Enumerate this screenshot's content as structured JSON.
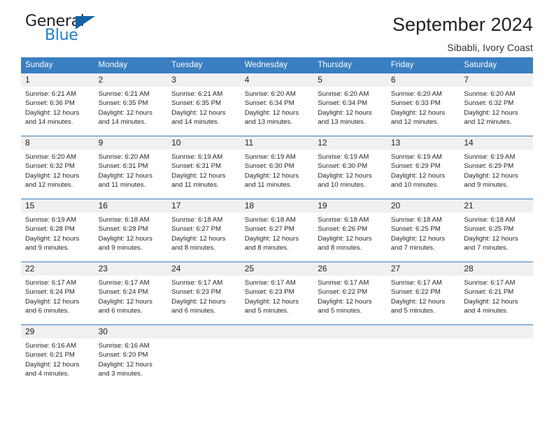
{
  "brand": {
    "name_part1": "General",
    "name_part2": "Blue"
  },
  "header": {
    "title": "September 2024",
    "subtitle": "Sibabli, Ivory Coast"
  },
  "weekday_headers": [
    "Sunday",
    "Monday",
    "Tuesday",
    "Wednesday",
    "Thursday",
    "Friday",
    "Saturday"
  ],
  "colors": {
    "header_blue": "#3a7fc1",
    "daynum_band": "#f0f0f0",
    "brand_blue": "#1f7ec4",
    "text": "#262626"
  },
  "weeks": [
    [
      {
        "day": "1",
        "sunrise": "Sunrise: 6:21 AM",
        "sunset": "Sunset: 6:36 PM",
        "daylight1": "Daylight: 12 hours",
        "daylight2": "and 14 minutes."
      },
      {
        "day": "2",
        "sunrise": "Sunrise: 6:21 AM",
        "sunset": "Sunset: 6:35 PM",
        "daylight1": "Daylight: 12 hours",
        "daylight2": "and 14 minutes."
      },
      {
        "day": "3",
        "sunrise": "Sunrise: 6:21 AM",
        "sunset": "Sunset: 6:35 PM",
        "daylight1": "Daylight: 12 hours",
        "daylight2": "and 14 minutes."
      },
      {
        "day": "4",
        "sunrise": "Sunrise: 6:20 AM",
        "sunset": "Sunset: 6:34 PM",
        "daylight1": "Daylight: 12 hours",
        "daylight2": "and 13 minutes."
      },
      {
        "day": "5",
        "sunrise": "Sunrise: 6:20 AM",
        "sunset": "Sunset: 6:34 PM",
        "daylight1": "Daylight: 12 hours",
        "daylight2": "and 13 minutes."
      },
      {
        "day": "6",
        "sunrise": "Sunrise: 6:20 AM",
        "sunset": "Sunset: 6:33 PM",
        "daylight1": "Daylight: 12 hours",
        "daylight2": "and 12 minutes."
      },
      {
        "day": "7",
        "sunrise": "Sunrise: 6:20 AM",
        "sunset": "Sunset: 6:32 PM",
        "daylight1": "Daylight: 12 hours",
        "daylight2": "and 12 minutes."
      }
    ],
    [
      {
        "day": "8",
        "sunrise": "Sunrise: 6:20 AM",
        "sunset": "Sunset: 6:32 PM",
        "daylight1": "Daylight: 12 hours",
        "daylight2": "and 12 minutes."
      },
      {
        "day": "9",
        "sunrise": "Sunrise: 6:20 AM",
        "sunset": "Sunset: 6:31 PM",
        "daylight1": "Daylight: 12 hours",
        "daylight2": "and 11 minutes."
      },
      {
        "day": "10",
        "sunrise": "Sunrise: 6:19 AM",
        "sunset": "Sunset: 6:31 PM",
        "daylight1": "Daylight: 12 hours",
        "daylight2": "and 11 minutes."
      },
      {
        "day": "11",
        "sunrise": "Sunrise: 6:19 AM",
        "sunset": "Sunset: 6:30 PM",
        "daylight1": "Daylight: 12 hours",
        "daylight2": "and 11 minutes."
      },
      {
        "day": "12",
        "sunrise": "Sunrise: 6:19 AM",
        "sunset": "Sunset: 6:30 PM",
        "daylight1": "Daylight: 12 hours",
        "daylight2": "and 10 minutes."
      },
      {
        "day": "13",
        "sunrise": "Sunrise: 6:19 AM",
        "sunset": "Sunset: 6:29 PM",
        "daylight1": "Daylight: 12 hours",
        "daylight2": "and 10 minutes."
      },
      {
        "day": "14",
        "sunrise": "Sunrise: 6:19 AM",
        "sunset": "Sunset: 6:29 PM",
        "daylight1": "Daylight: 12 hours",
        "daylight2": "and 9 minutes."
      }
    ],
    [
      {
        "day": "15",
        "sunrise": "Sunrise: 6:19 AM",
        "sunset": "Sunset: 6:28 PM",
        "daylight1": "Daylight: 12 hours",
        "daylight2": "and 9 minutes."
      },
      {
        "day": "16",
        "sunrise": "Sunrise: 6:18 AM",
        "sunset": "Sunset: 6:28 PM",
        "daylight1": "Daylight: 12 hours",
        "daylight2": "and 9 minutes."
      },
      {
        "day": "17",
        "sunrise": "Sunrise: 6:18 AM",
        "sunset": "Sunset: 6:27 PM",
        "daylight1": "Daylight: 12 hours",
        "daylight2": "and 8 minutes."
      },
      {
        "day": "18",
        "sunrise": "Sunrise: 6:18 AM",
        "sunset": "Sunset: 6:27 PM",
        "daylight1": "Daylight: 12 hours",
        "daylight2": "and 8 minutes."
      },
      {
        "day": "19",
        "sunrise": "Sunrise: 6:18 AM",
        "sunset": "Sunset: 6:26 PM",
        "daylight1": "Daylight: 12 hours",
        "daylight2": "and 8 minutes."
      },
      {
        "day": "20",
        "sunrise": "Sunrise: 6:18 AM",
        "sunset": "Sunset: 6:25 PM",
        "daylight1": "Daylight: 12 hours",
        "daylight2": "and 7 minutes."
      },
      {
        "day": "21",
        "sunrise": "Sunrise: 6:18 AM",
        "sunset": "Sunset: 6:25 PM",
        "daylight1": "Daylight: 12 hours",
        "daylight2": "and 7 minutes."
      }
    ],
    [
      {
        "day": "22",
        "sunrise": "Sunrise: 6:17 AM",
        "sunset": "Sunset: 6:24 PM",
        "daylight1": "Daylight: 12 hours",
        "daylight2": "and 6 minutes."
      },
      {
        "day": "23",
        "sunrise": "Sunrise: 6:17 AM",
        "sunset": "Sunset: 6:24 PM",
        "daylight1": "Daylight: 12 hours",
        "daylight2": "and 6 minutes."
      },
      {
        "day": "24",
        "sunrise": "Sunrise: 6:17 AM",
        "sunset": "Sunset: 6:23 PM",
        "daylight1": "Daylight: 12 hours",
        "daylight2": "and 6 minutes."
      },
      {
        "day": "25",
        "sunrise": "Sunrise: 6:17 AM",
        "sunset": "Sunset: 6:23 PM",
        "daylight1": "Daylight: 12 hours",
        "daylight2": "and 5 minutes."
      },
      {
        "day": "26",
        "sunrise": "Sunrise: 6:17 AM",
        "sunset": "Sunset: 6:22 PM",
        "daylight1": "Daylight: 12 hours",
        "daylight2": "and 5 minutes."
      },
      {
        "day": "27",
        "sunrise": "Sunrise: 6:17 AM",
        "sunset": "Sunset: 6:22 PM",
        "daylight1": "Daylight: 12 hours",
        "daylight2": "and 5 minutes."
      },
      {
        "day": "28",
        "sunrise": "Sunrise: 6:17 AM",
        "sunset": "Sunset: 6:21 PM",
        "daylight1": "Daylight: 12 hours",
        "daylight2": "and 4 minutes."
      }
    ],
    [
      {
        "day": "29",
        "sunrise": "Sunrise: 6:16 AM",
        "sunset": "Sunset: 6:21 PM",
        "daylight1": "Daylight: 12 hours",
        "daylight2": "and 4 minutes."
      },
      {
        "day": "30",
        "sunrise": "Sunrise: 6:16 AM",
        "sunset": "Sunset: 6:20 PM",
        "daylight1": "Daylight: 12 hours",
        "daylight2": "and 3 minutes."
      },
      {
        "day": "",
        "sunrise": "",
        "sunset": "",
        "daylight1": "",
        "daylight2": ""
      },
      {
        "day": "",
        "sunrise": "",
        "sunset": "",
        "daylight1": "",
        "daylight2": ""
      },
      {
        "day": "",
        "sunrise": "",
        "sunset": "",
        "daylight1": "",
        "daylight2": ""
      },
      {
        "day": "",
        "sunrise": "",
        "sunset": "",
        "daylight1": "",
        "daylight2": ""
      },
      {
        "day": "",
        "sunrise": "",
        "sunset": "",
        "daylight1": "",
        "daylight2": ""
      }
    ]
  ]
}
